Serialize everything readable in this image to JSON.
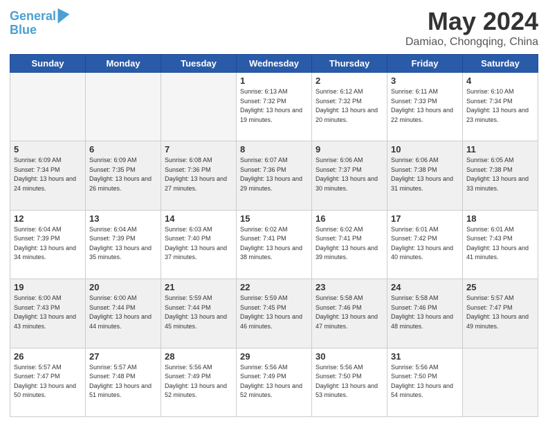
{
  "header": {
    "logo_line1": "General",
    "logo_line2": "Blue",
    "month": "May 2024",
    "location": "Damiao, Chongqing, China"
  },
  "weekdays": [
    "Sunday",
    "Monday",
    "Tuesday",
    "Wednesday",
    "Thursday",
    "Friday",
    "Saturday"
  ],
  "weeks": [
    [
      {
        "day": "",
        "sunrise": "",
        "sunset": "",
        "daylight": "",
        "empty": true
      },
      {
        "day": "",
        "sunrise": "",
        "sunset": "",
        "daylight": "",
        "empty": true
      },
      {
        "day": "",
        "sunrise": "",
        "sunset": "",
        "daylight": "",
        "empty": true
      },
      {
        "day": "1",
        "sunrise": "Sunrise: 6:13 AM",
        "sunset": "Sunset: 7:32 PM",
        "daylight": "Daylight: 13 hours and 19 minutes."
      },
      {
        "day": "2",
        "sunrise": "Sunrise: 6:12 AM",
        "sunset": "Sunset: 7:32 PM",
        "daylight": "Daylight: 13 hours and 20 minutes."
      },
      {
        "day": "3",
        "sunrise": "Sunrise: 6:11 AM",
        "sunset": "Sunset: 7:33 PM",
        "daylight": "Daylight: 13 hours and 22 minutes."
      },
      {
        "day": "4",
        "sunrise": "Sunrise: 6:10 AM",
        "sunset": "Sunset: 7:34 PM",
        "daylight": "Daylight: 13 hours and 23 minutes."
      }
    ],
    [
      {
        "day": "5",
        "sunrise": "Sunrise: 6:09 AM",
        "sunset": "Sunset: 7:34 PM",
        "daylight": "Daylight: 13 hours and 24 minutes."
      },
      {
        "day": "6",
        "sunrise": "Sunrise: 6:09 AM",
        "sunset": "Sunset: 7:35 PM",
        "daylight": "Daylight: 13 hours and 26 minutes."
      },
      {
        "day": "7",
        "sunrise": "Sunrise: 6:08 AM",
        "sunset": "Sunset: 7:36 PM",
        "daylight": "Daylight: 13 hours and 27 minutes."
      },
      {
        "day": "8",
        "sunrise": "Sunrise: 6:07 AM",
        "sunset": "Sunset: 7:36 PM",
        "daylight": "Daylight: 13 hours and 29 minutes."
      },
      {
        "day": "9",
        "sunrise": "Sunrise: 6:06 AM",
        "sunset": "Sunset: 7:37 PM",
        "daylight": "Daylight: 13 hours and 30 minutes."
      },
      {
        "day": "10",
        "sunrise": "Sunrise: 6:06 AM",
        "sunset": "Sunset: 7:38 PM",
        "daylight": "Daylight: 13 hours and 31 minutes."
      },
      {
        "day": "11",
        "sunrise": "Sunrise: 6:05 AM",
        "sunset": "Sunset: 7:38 PM",
        "daylight": "Daylight: 13 hours and 33 minutes."
      }
    ],
    [
      {
        "day": "12",
        "sunrise": "Sunrise: 6:04 AM",
        "sunset": "Sunset: 7:39 PM",
        "daylight": "Daylight: 13 hours and 34 minutes."
      },
      {
        "day": "13",
        "sunrise": "Sunrise: 6:04 AM",
        "sunset": "Sunset: 7:39 PM",
        "daylight": "Daylight: 13 hours and 35 minutes."
      },
      {
        "day": "14",
        "sunrise": "Sunrise: 6:03 AM",
        "sunset": "Sunset: 7:40 PM",
        "daylight": "Daylight: 13 hours and 37 minutes."
      },
      {
        "day": "15",
        "sunrise": "Sunrise: 6:02 AM",
        "sunset": "Sunset: 7:41 PM",
        "daylight": "Daylight: 13 hours and 38 minutes."
      },
      {
        "day": "16",
        "sunrise": "Sunrise: 6:02 AM",
        "sunset": "Sunset: 7:41 PM",
        "daylight": "Daylight: 13 hours and 39 minutes."
      },
      {
        "day": "17",
        "sunrise": "Sunrise: 6:01 AM",
        "sunset": "Sunset: 7:42 PM",
        "daylight": "Daylight: 13 hours and 40 minutes."
      },
      {
        "day": "18",
        "sunrise": "Sunrise: 6:01 AM",
        "sunset": "Sunset: 7:43 PM",
        "daylight": "Daylight: 13 hours and 41 minutes."
      }
    ],
    [
      {
        "day": "19",
        "sunrise": "Sunrise: 6:00 AM",
        "sunset": "Sunset: 7:43 PM",
        "daylight": "Daylight: 13 hours and 43 minutes."
      },
      {
        "day": "20",
        "sunrise": "Sunrise: 6:00 AM",
        "sunset": "Sunset: 7:44 PM",
        "daylight": "Daylight: 13 hours and 44 minutes."
      },
      {
        "day": "21",
        "sunrise": "Sunrise: 5:59 AM",
        "sunset": "Sunset: 7:44 PM",
        "daylight": "Daylight: 13 hours and 45 minutes."
      },
      {
        "day": "22",
        "sunrise": "Sunrise: 5:59 AM",
        "sunset": "Sunset: 7:45 PM",
        "daylight": "Daylight: 13 hours and 46 minutes."
      },
      {
        "day": "23",
        "sunrise": "Sunrise: 5:58 AM",
        "sunset": "Sunset: 7:46 PM",
        "daylight": "Daylight: 13 hours and 47 minutes."
      },
      {
        "day": "24",
        "sunrise": "Sunrise: 5:58 AM",
        "sunset": "Sunset: 7:46 PM",
        "daylight": "Daylight: 13 hours and 48 minutes."
      },
      {
        "day": "25",
        "sunrise": "Sunrise: 5:57 AM",
        "sunset": "Sunset: 7:47 PM",
        "daylight": "Daylight: 13 hours and 49 minutes."
      }
    ],
    [
      {
        "day": "26",
        "sunrise": "Sunrise: 5:57 AM",
        "sunset": "Sunset: 7:47 PM",
        "daylight": "Daylight: 13 hours and 50 minutes."
      },
      {
        "day": "27",
        "sunrise": "Sunrise: 5:57 AM",
        "sunset": "Sunset: 7:48 PM",
        "daylight": "Daylight: 13 hours and 51 minutes."
      },
      {
        "day": "28",
        "sunrise": "Sunrise: 5:56 AM",
        "sunset": "Sunset: 7:49 PM",
        "daylight": "Daylight: 13 hours and 52 minutes."
      },
      {
        "day": "29",
        "sunrise": "Sunrise: 5:56 AM",
        "sunset": "Sunset: 7:49 PM",
        "daylight": "Daylight: 13 hours and 52 minutes."
      },
      {
        "day": "30",
        "sunrise": "Sunrise: 5:56 AM",
        "sunset": "Sunset: 7:50 PM",
        "daylight": "Daylight: 13 hours and 53 minutes."
      },
      {
        "day": "31",
        "sunrise": "Sunrise: 5:56 AM",
        "sunset": "Sunset: 7:50 PM",
        "daylight": "Daylight: 13 hours and 54 minutes."
      },
      {
        "day": "",
        "sunrise": "",
        "sunset": "",
        "daylight": "",
        "empty": true
      }
    ]
  ],
  "colors": {
    "header_bg": "#2a5ba8",
    "row_shaded": "#f0f0f0"
  }
}
